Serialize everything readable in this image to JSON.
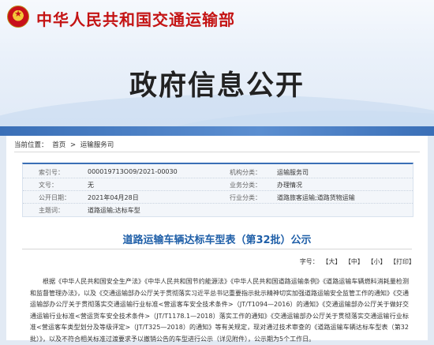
{
  "site": {
    "title": "中华人民共和国交通运输部"
  },
  "page": {
    "heading": "政府信息公开"
  },
  "breadcrumb": {
    "prefix": "当前位置：",
    "items": [
      "首页",
      "运输服务司"
    ],
    "separator": ">"
  },
  "meta": {
    "index_no": {
      "label": "索引号：",
      "value": "000019713O09/2021-00030"
    },
    "agency": {
      "label": "机构分类：",
      "value": "运输服务司"
    },
    "doc_no": {
      "label": "文号：",
      "value": "无"
    },
    "business": {
      "label": "业务分类：",
      "value": "办理情况"
    },
    "date": {
      "label": "公开日期：",
      "value": "2021年04月28日"
    },
    "industry": {
      "label": "行业分类：",
      "value": "道路旅客运输;道路货物运输"
    },
    "keywords": {
      "label": "主题词：",
      "value": "道路运输;达标车型"
    }
  },
  "article": {
    "title": "道路运输车辆达标车型表（第32批）公示",
    "body": "根据《中华人民共和国安全生产法》《中华人民共和国节约能源法》《中华人民共和国道路运输条例》《道路运输车辆燃料消耗量检测和监督管理办法》，以及《交通运输部办公厅关于贯彻落实习近平总书记重要指示批示精神切实加强道路运输安全监管工作的通知》《交通运输部办公厅关于贯彻落实交通运输行业标准<营运客车安全技术条件>（JT/T1094—2016）的通知》《交通运输部办公厅关于做好交通运输行业标准<营运货车安全技术条件>（JT/T1178.1—2018）落实工作的通知》《交通运输部办公厅关于贯彻落实交通运输行业标准<营运客车类型划分及等级评定>（JT/T325—2018）的通知》等有关规定，现对通过技术审查的《道路运输车辆达标车型表（第32批）》，以及不符合相关标准过渡要求予以撤销公告的车型进行公示（详见附件），公示期为5个工作日。"
  },
  "font_controls": {
    "label": "字号：",
    "large": "【大】",
    "medium": "【中】",
    "small": "【小】",
    "print": "【打印】"
  }
}
